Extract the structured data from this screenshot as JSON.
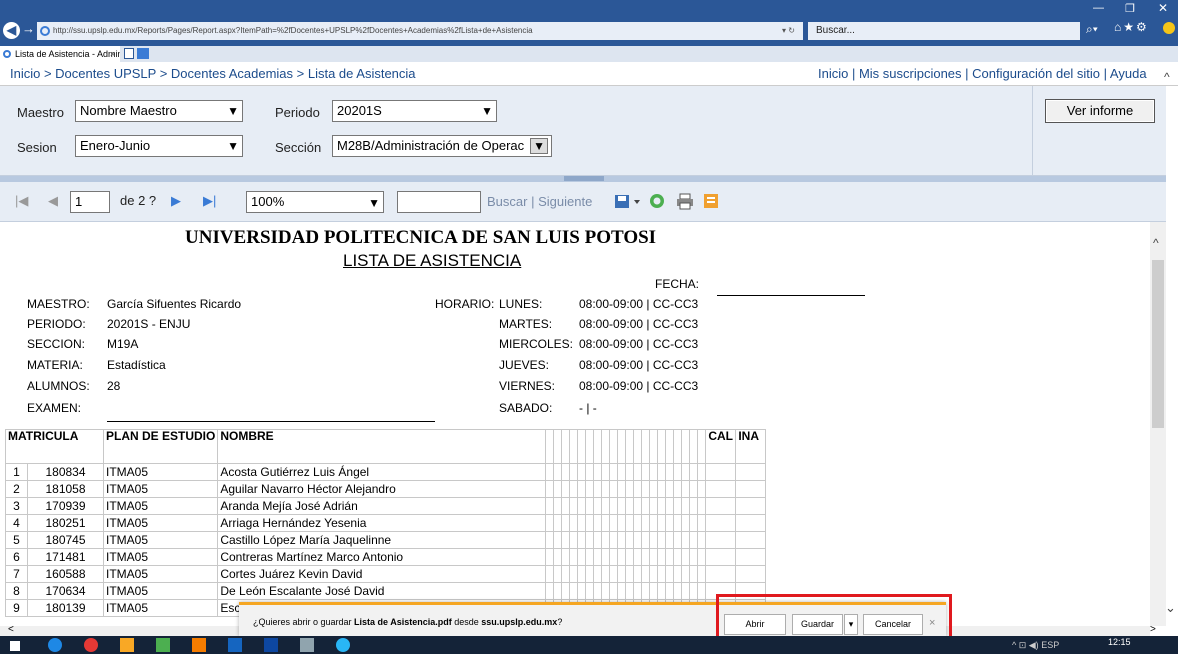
{
  "browser": {
    "address": "http://ssu.upslp.edu.mx/Reports/Pages/Report.aspx?ItemPath=%2fDocentes+UPSLP%2fDocentes+Academias%2fLista+de+Asistencia",
    "search_placeholder": "Buscar...",
    "tab_title": "Lista de Asistencia - Admini...",
    "tab_close": "×"
  },
  "breadcrumb": "Inicio > Docentes UPSLP > Docentes Academias > Lista de Asistencia",
  "top_links": "Inicio | Mis suscripciones | Configuración del sitio | Ayuda",
  "params": {
    "maestro_label": "Maestro",
    "maestro_value": "Nombre Maestro",
    "periodo_label": "Periodo",
    "periodo_value": "20201S",
    "sesion_label": "Sesion",
    "sesion_value": "Enero-Junio",
    "seccion_label": "Sección",
    "seccion_value": "M28B/Administración de Operac",
    "view_button": "Ver informe"
  },
  "toolbar": {
    "page": "1",
    "of_pages": "de 2 ?",
    "zoom": "100%",
    "find": "Buscar",
    "sep": "|",
    "next": "Siguiente"
  },
  "report": {
    "university": "UNIVERSIDAD POLITECNICA DE SAN LUIS POTOSI",
    "list_title": "LISTA DE ASISTENCIA",
    "fecha_label": "FECHA:",
    "header_left": [
      {
        "label": "MAESTRO:",
        "value": "García Sifuentes Ricardo"
      },
      {
        "label": "PERIODO:",
        "value": "20201S - ENJU"
      },
      {
        "label": "SECCION:",
        "value": "M19A"
      },
      {
        "label": "MATERIA:",
        "value": "Estadística"
      },
      {
        "label": "ALUMNOS:",
        "value": "28"
      },
      {
        "label": "EXAMEN:",
        "value": ""
      }
    ],
    "horario_label": "HORARIO:",
    "schedule": [
      {
        "day": "LUNES:",
        "time": "08:00-09:00 | CC-CC3"
      },
      {
        "day": "MARTES:",
        "time": "08:00-09:00 | CC-CC3"
      },
      {
        "day": "MIERCOLES:",
        "time": "08:00-09:00 | CC-CC3"
      },
      {
        "day": "JUEVES:",
        "time": "08:00-09:00 | CC-CC3"
      },
      {
        "day": "VIERNES:",
        "time": "08:00-09:00 | CC-CC3"
      },
      {
        "day": "SABADO:",
        "time": "- | -"
      }
    ],
    "columns": {
      "matricula": "MATRICULA",
      "plan": "PLAN DE ESTUDIO",
      "nombre": "NOMBRE",
      "cal": "CAL",
      "ina": "INA"
    },
    "students": [
      {
        "n": "1",
        "matricula": "180834",
        "plan": "ITMA05",
        "nombre": "Acosta Gutiérrez Luis Ángel"
      },
      {
        "n": "2",
        "matricula": "181058",
        "plan": "ITMA05",
        "nombre": "Aguilar Navarro Héctor Alejandro"
      },
      {
        "n": "3",
        "matricula": "170939",
        "plan": "ITMA05",
        "nombre": "Aranda Mejía José Adrián"
      },
      {
        "n": "4",
        "matricula": "180251",
        "plan": "ITMA05",
        "nombre": "Arriaga Hernández Yesenia"
      },
      {
        "n": "5",
        "matricula": "180745",
        "plan": "ITMA05",
        "nombre": "Castillo López María Jaquelinne"
      },
      {
        "n": "6",
        "matricula": "171481",
        "plan": "ITMA05",
        "nombre": "Contreras Martínez Marco Antonio"
      },
      {
        "n": "7",
        "matricula": "160588",
        "plan": "ITMA05",
        "nombre": "Cortes Juárez Kevin David"
      },
      {
        "n": "8",
        "matricula": "170634",
        "plan": "ITMA05",
        "nombre": "De León Escalante José David"
      },
      {
        "n": "9",
        "matricula": "180139",
        "plan": "ITMA05",
        "nombre": "Escalante Jo"
      }
    ]
  },
  "download_bar": {
    "message_prefix": "¿Quieres abrir o guardar ",
    "file": "Lista de Asistencia.pdf",
    "message_mid": " desde ",
    "site": "ssu.upslp.edu.mx",
    "message_suffix": "?",
    "open": "Abrir",
    "save": "Guardar",
    "cancel": "Cancelar",
    "close": "×"
  },
  "taskbar": {
    "clock": "12:15",
    "lang": "ESP"
  },
  "colors": {
    "accent": "#2b5797",
    "link": "#1c4c8c",
    "highlight": "#e0191e",
    "notify": "#f5a623"
  },
  "icons": [
    "back-icon",
    "forward-icon",
    "ie-icon",
    "search-icon",
    "home-icon",
    "star-icon",
    "gear-icon",
    "smiley-icon",
    "first-page-icon",
    "prev-page-icon",
    "next-page-icon",
    "last-page-icon",
    "export-icon",
    "refresh-icon",
    "print-icon",
    "datafeed-icon"
  ]
}
